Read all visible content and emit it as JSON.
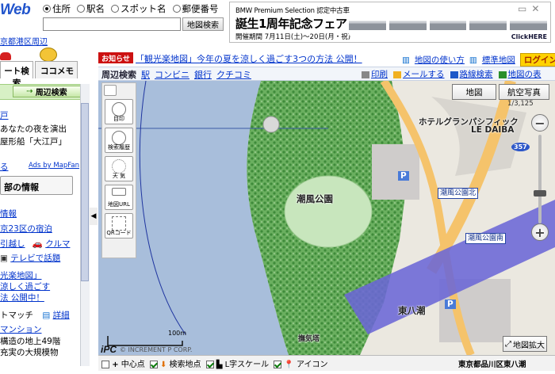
{
  "header": {
    "logo": "Web",
    "radios": [
      {
        "label": "住所",
        "selected": true
      },
      {
        "label": "駅名",
        "selected": false
      },
      {
        "label": "スポット名",
        "selected": false
      },
      {
        "label": "郵便番号",
        "selected": false
      }
    ],
    "search_value": "",
    "search_button": "地図検索",
    "area_link": "京都港区周辺"
  },
  "ad": {
    "line1": "BMW Premium Selection 認定中古車",
    "line2": "誕生1周年記念フェア",
    "line3": "開催期間 7月11日(土)〜20日(月・祝)",
    "click": "ClickHERE"
  },
  "sidebar": {
    "tabs": [
      "ート検索",
      "ココメモ"
    ],
    "search_button": "周辺検索",
    "lines": [
      "戸",
      "あなたの夜を演出",
      "屋形船「大江戸」"
    ],
    "more_link": "る",
    "mapfan_link": "Ads by MapFan",
    "card_title": "部の情報",
    "links": [
      "情報",
      "京23区の宿泊",
      "引越し",
      "クルマ",
      "テレビで話題",
      "光楽地図」",
      "涼しく過ごす",
      "法 公開中！"
    ],
    "match_label": "トマッチ",
    "detail_link": "詳細",
    "bottom_lines": [
      "マンション",
      "構造の地上49階",
      "充実の大規模物"
    ]
  },
  "notice": {
    "tag": "お知らせ",
    "text": "「観光楽地図」今年の夏を涼しく過ごす3つの方法 公開！"
  },
  "toplinks": {
    "how_to": "地図の使い方",
    "standard": "標準地図",
    "login": "ログイン"
  },
  "mapbar": {
    "label": "周辺検索",
    "links": [
      "駅",
      "コンビニ",
      "銀行",
      "クチコミ"
    ],
    "print": "印刷",
    "mail": "メールする",
    "route": "路線検索",
    "more": "地図の表"
  },
  "map": {
    "buttons": [
      "地図",
      "航空写真"
    ],
    "scale": "1/3,125",
    "tools": [
      {
        "name": "目印",
        "icon": "pin-icon"
      },
      {
        "name": "検索履歴",
        "icon": "clock-icon"
      },
      {
        "name": "天 気",
        "icon": "sun-icon"
      },
      {
        "name": "地図URL",
        "icon": "url-icon"
      },
      {
        "name": "QRコード",
        "icon": "qr-icon"
      }
    ],
    "labels": {
      "hotel1": "ホテルグランパシフィック",
      "hotel2": "LE DAIBA",
      "park": "潮風公園",
      "area": "東八潮",
      "tower": "撫気塔",
      "route": "357"
    },
    "stations": [
      "潮風公園北",
      "潮風公園南"
    ],
    "scale_label": "100m",
    "copyright": "© INCREMENT P CORP.",
    "big_map": "地図拡大"
  },
  "bottombar": {
    "items": [
      {
        "label": "中心点",
        "checked": false
      },
      {
        "label": "検索地点",
        "checked": true
      },
      {
        "label": "L字スケール",
        "checked": true
      },
      {
        "label": "アイコン",
        "checked": true
      }
    ],
    "address": "東京都品川区東八潮"
  },
  "colors": {
    "accent_blue": "#0033cc",
    "water": "#a7bcd9",
    "park_green": "#74b46a",
    "road": "#f5c36b",
    "highway_purple": "#6b66d6",
    "notice_red": "#cc1111",
    "login_yellow": "#ffd200"
  }
}
